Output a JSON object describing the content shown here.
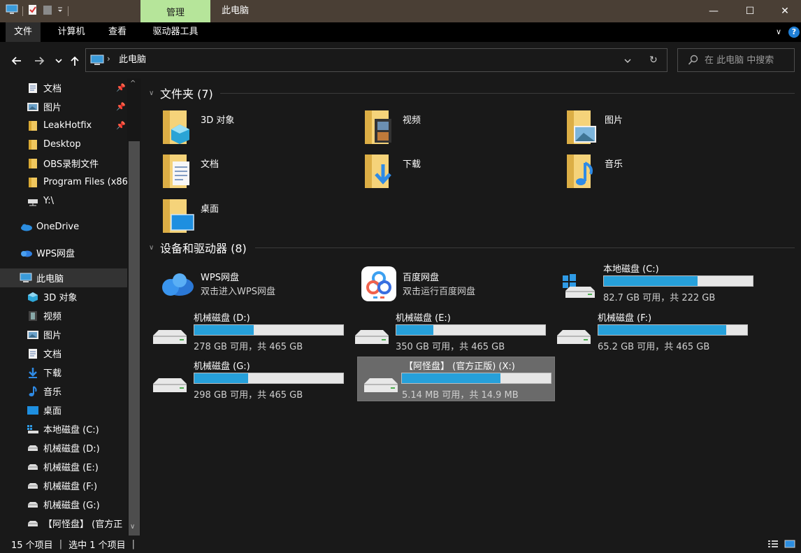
{
  "window": {
    "context_tab": "管理",
    "title": "此电脑",
    "minimize": "—",
    "maximize": "☐",
    "close": "✕"
  },
  "ribbon": {
    "tabs": [
      {
        "label": "文件",
        "active": true
      },
      {
        "label": "计算机",
        "active": false
      },
      {
        "label": "查看",
        "active": false
      },
      {
        "label": "驱动器工具",
        "active": false
      }
    ],
    "collapse": "∨",
    "help": "?"
  },
  "address": {
    "path": "此电脑",
    "search_placeholder": "在 此电脑 中搜索"
  },
  "sidebar": {
    "quick_access": [
      {
        "label": "文档",
        "pinned": true,
        "icon": "document-icon"
      },
      {
        "label": "图片",
        "pinned": true,
        "icon": "pictures-icon"
      },
      {
        "label": "LeakHotfix",
        "pinned": true,
        "icon": "folder-icon"
      },
      {
        "label": "Desktop",
        "pinned": false,
        "icon": "folder-icon"
      },
      {
        "label": "OBS录制文件",
        "pinned": false,
        "icon": "folder-icon"
      },
      {
        "label": "Program Files (x86",
        "pinned": false,
        "icon": "folder-icon"
      },
      {
        "label": "Y:\\",
        "pinned": false,
        "icon": "network-drive-icon"
      }
    ],
    "onedrive": "OneDrive",
    "wps": "WPS网盘",
    "this_pc": "此电脑",
    "pc_children": [
      {
        "label": "3D 对象",
        "icon": "3d-objects-icon"
      },
      {
        "label": "视频",
        "icon": "video-icon"
      },
      {
        "label": "图片",
        "icon": "pictures-icon"
      },
      {
        "label": "文档",
        "icon": "document-icon"
      },
      {
        "label": "下载",
        "icon": "download-icon"
      },
      {
        "label": "音乐",
        "icon": "music-icon"
      },
      {
        "label": "桌面",
        "icon": "desktop-icon"
      },
      {
        "label": "本地磁盘 (C:)",
        "icon": "windows-drive-icon"
      },
      {
        "label": "机械磁盘 (D:)",
        "icon": "drive-icon"
      },
      {
        "label": "机械磁盘 (E:)",
        "icon": "drive-icon"
      },
      {
        "label": "机械磁盘 (F:)",
        "icon": "drive-icon"
      },
      {
        "label": "机械磁盘 (G:)",
        "icon": "drive-icon"
      },
      {
        "label": "【阿怪盘】 (官方正",
        "icon": "drive-icon"
      }
    ]
  },
  "folders": {
    "header": "文件夹 (7)",
    "items": [
      {
        "label": "3D 对象",
        "icon": "3d-objects-icon"
      },
      {
        "label": "视频",
        "icon": "video-icon"
      },
      {
        "label": "图片",
        "icon": "pictures-icon"
      },
      {
        "label": "文档",
        "icon": "document-icon"
      },
      {
        "label": "下载",
        "icon": "download-icon"
      },
      {
        "label": "音乐",
        "icon": "music-icon"
      },
      {
        "label": "桌面",
        "icon": "desktop-icon"
      }
    ]
  },
  "devices": {
    "header": "设备和驱动器 (8)",
    "clouds": [
      {
        "name": "WPS网盘",
        "desc": "双击进入WPS网盘",
        "icon": "wps-cloud-icon"
      },
      {
        "name": "百度网盘",
        "desc": "双击运行百度网盘",
        "icon": "baidu-netdisk-icon"
      }
    ],
    "drives": [
      {
        "name": "本地磁盘 (C:)",
        "info": "82.7 GB 可用，共 222 GB",
        "used": 0.63,
        "icon": "windows-drive-icon",
        "selected": false
      },
      {
        "name": "机械磁盘 (D:)",
        "info": "278 GB 可用，共 465 GB",
        "used": 0.4,
        "icon": "drive-icon",
        "selected": false
      },
      {
        "name": "机械磁盘 (E:)",
        "info": "350 GB 可用，共 465 GB",
        "used": 0.25,
        "icon": "drive-icon",
        "selected": false
      },
      {
        "name": "机械磁盘 (F:)",
        "info": "65.2 GB 可用，共 465 GB",
        "used": 0.86,
        "icon": "drive-icon",
        "selected": false
      },
      {
        "name": "机械磁盘 (G:)",
        "info": "298 GB 可用，共 465 GB",
        "used": 0.36,
        "icon": "drive-icon",
        "selected": false
      },
      {
        "name": "【阿怪盘】 (官方正版)  (X:)",
        "info": "5.14 MB 可用，共 14.9 MB",
        "used": 0.66,
        "icon": "drive-icon",
        "selected": true
      }
    ]
  },
  "status": {
    "count": "15 个项目",
    "selection": "选中 1 个项目"
  },
  "colors": {
    "accent_bar": "#26a0da",
    "context_tab": "#b6e59a",
    "titlebar": "#4a3f35"
  }
}
